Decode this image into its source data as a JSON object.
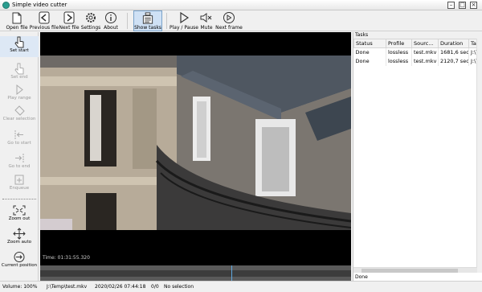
{
  "window": {
    "title": "Simple video cutter"
  },
  "toolbar": {
    "open_file": "Open file",
    "previous_file": "Previous file",
    "next_file": "Next file",
    "settings": "Settings",
    "about": "About",
    "show_tasks": "Show tasks",
    "play_pause": "Play / Pause",
    "mute": "Mute",
    "next_frame": "Next frame"
  },
  "left_panel": {
    "set_start": "Set start",
    "set_end": "Set end",
    "play_range": "Play range",
    "clear_selection": "Clear selection",
    "go_to_start": "Go to start",
    "go_to_end": "Go to end",
    "enqueue": "Enqueue",
    "zoom_out": "Zoom out",
    "zoom_auto": "Zoom auto",
    "current_position": "Current position"
  },
  "player": {
    "time_label": "Time: 01:31:55.320"
  },
  "tasks": {
    "panel_title": "Tasks",
    "columns": [
      "Status",
      "Profile",
      "Sourc...",
      "Duration",
      "Tar"
    ],
    "rows": [
      [
        "Done",
        "lossless",
        "test.mkv",
        "1681,6 sec",
        "J:\\T"
      ],
      [
        "Done",
        "lossless",
        "test.mkv",
        "2120,7 sec",
        "J:\\T"
      ]
    ],
    "status_text": "Done"
  },
  "statusbar": {
    "volume": "Volume: 100%",
    "file": "J:\\Temp\\test.mkv",
    "datetime": "2020/02/26 07:44:18",
    "counter": "0/0",
    "selection": "No selection"
  }
}
